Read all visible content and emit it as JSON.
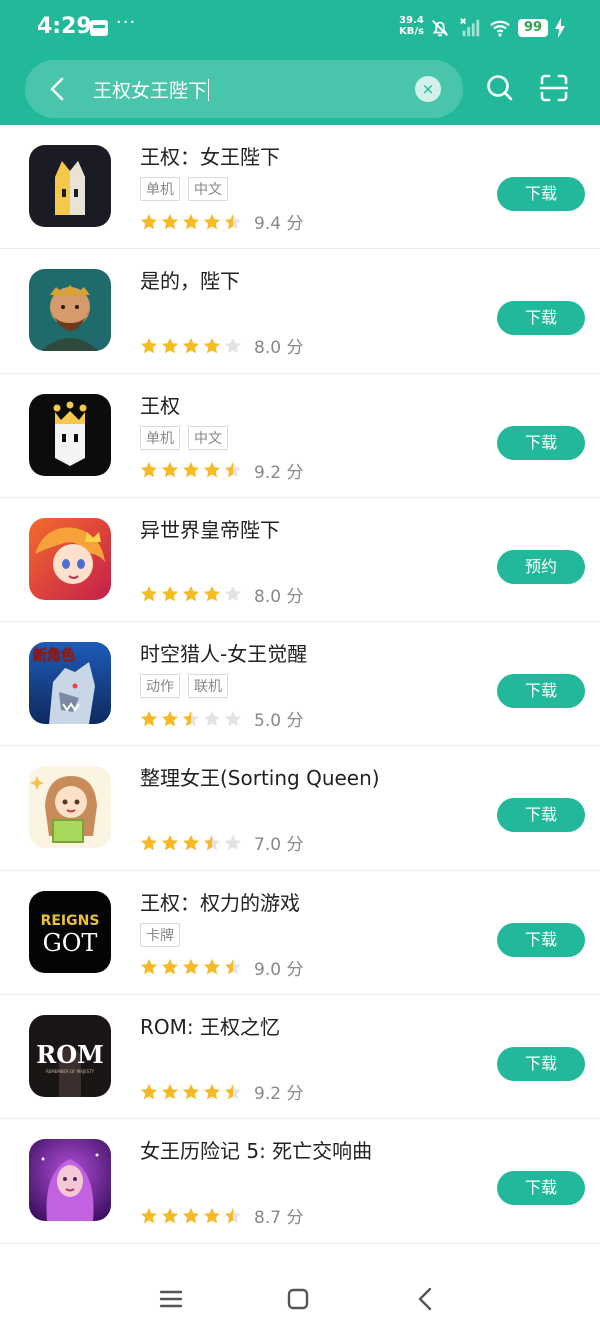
{
  "status_bar": {
    "time": "4:29",
    "more": "···",
    "net_speed_value": "39.4",
    "net_speed_unit": "KB/s",
    "battery": "99"
  },
  "search": {
    "query": "王权女王陛下",
    "clear": "×"
  },
  "apps": [
    {
      "name": "王权：女王陛下",
      "tags": [
        "单机",
        "中文"
      ],
      "stars": 4.5,
      "score": "9.4 分",
      "action": "下载"
    },
    {
      "name": "是的，陛下",
      "tags": [],
      "stars": 4,
      "score": "8.0 分",
      "action": "下载"
    },
    {
      "name": "王权",
      "tags": [
        "单机",
        "中文"
      ],
      "stars": 4.5,
      "score": "9.2 分",
      "action": "下载"
    },
    {
      "name": "异世界皇帝陛下",
      "tags": [],
      "stars": 4,
      "score": "8.0 分",
      "action": "预约"
    },
    {
      "name": "时空猎人-女王觉醒",
      "tags": [
        "动作",
        "联机"
      ],
      "stars": 2.5,
      "score": "5.0 分",
      "action": "下载"
    },
    {
      "name": "整理女王(Sorting Queen)",
      "tags": [],
      "stars": 3.5,
      "score": "7.0 分",
      "action": "下载"
    },
    {
      "name": "王权：权力的游戏",
      "tags": [
        "卡牌"
      ],
      "stars": 4.5,
      "score": "9.0 分",
      "action": "下载"
    },
    {
      "name": "ROM: 王权之忆",
      "tags": [],
      "stars": 4.5,
      "score": "9.2 分",
      "action": "下载"
    },
    {
      "name": "女王历险记 5: 死亡交响曲",
      "tags": [],
      "stars": 4.5,
      "score": "8.7 分",
      "action": "下载"
    }
  ],
  "icon_text": {
    "got_top": "REIGNS",
    "got_bottom": "GOT",
    "rom": "ROM",
    "rom_sub": "REMEMBER OF MAJESTY",
    "hunter_badge": "新角色"
  },
  "colors": {
    "accent": "#22b99a",
    "star": "#f7b924",
    "star_empty": "#e3e3e3"
  }
}
